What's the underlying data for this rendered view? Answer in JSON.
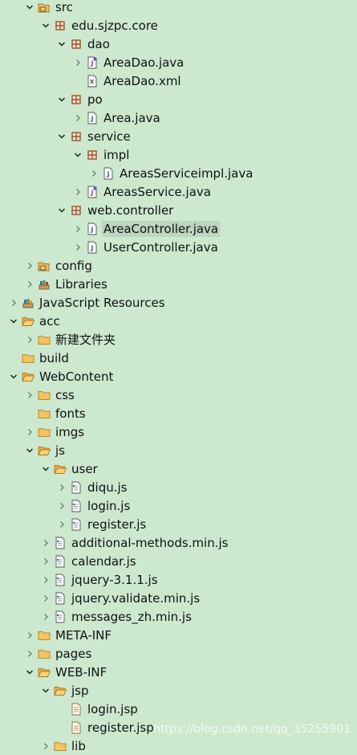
{
  "tree": [
    {
      "label": "src",
      "depth": 2,
      "twisty": "expanded",
      "icon": "source-folder-icon"
    },
    {
      "label": "edu.sjzpc.core",
      "depth": 3,
      "twisty": "expanded",
      "icon": "package-icon"
    },
    {
      "label": "dao",
      "depth": 4,
      "twisty": "expanded",
      "icon": "package-icon"
    },
    {
      "label": "AreaDao.java",
      "depth": 5,
      "twisty": "collapsed",
      "icon": "java-interface-icon"
    },
    {
      "label": "AreaDao.xml",
      "depth": 5,
      "twisty": "none",
      "icon": "xml-file-icon"
    },
    {
      "label": "po",
      "depth": 4,
      "twisty": "expanded",
      "icon": "package-icon"
    },
    {
      "label": "Area.java",
      "depth": 5,
      "twisty": "collapsed",
      "icon": "java-file-icon"
    },
    {
      "label": "service",
      "depth": 4,
      "twisty": "expanded",
      "icon": "package-icon"
    },
    {
      "label": "impl",
      "depth": 5,
      "twisty": "expanded",
      "icon": "package-icon"
    },
    {
      "label": "AreasServiceimpl.java",
      "depth": 6,
      "twisty": "collapsed",
      "icon": "java-file-icon"
    },
    {
      "label": "AreasService.java",
      "depth": 5,
      "twisty": "collapsed",
      "icon": "java-interface-icon"
    },
    {
      "label": "web.controller",
      "depth": 4,
      "twisty": "expanded",
      "icon": "package-icon"
    },
    {
      "label": "AreaController.java",
      "depth": 5,
      "twisty": "collapsed",
      "icon": "java-file-icon",
      "selected": true
    },
    {
      "label": "UserController.java",
      "depth": 5,
      "twisty": "collapsed",
      "icon": "java-file-icon"
    },
    {
      "label": "config",
      "depth": 2,
      "twisty": "collapsed",
      "icon": "source-folder-icon"
    },
    {
      "label": "Libraries",
      "depth": 2,
      "twisty": "collapsed",
      "icon": "libraries-icon"
    },
    {
      "label": "JavaScript Resources",
      "depth": 1,
      "twisty": "collapsed",
      "icon": "js-resources-icon"
    },
    {
      "label": "acc",
      "depth": 1,
      "twisty": "expanded",
      "icon": "folder-open-icon"
    },
    {
      "label": "新建文件夹",
      "depth": 2,
      "twisty": "collapsed",
      "icon": "folder-icon"
    },
    {
      "label": "build",
      "depth": 1,
      "twisty": "none",
      "icon": "folder-icon"
    },
    {
      "label": "WebContent",
      "depth": 1,
      "twisty": "expanded",
      "icon": "folder-open-icon"
    },
    {
      "label": "css",
      "depth": 2,
      "twisty": "collapsed",
      "icon": "folder-icon"
    },
    {
      "label": "fonts",
      "depth": 2,
      "twisty": "none",
      "icon": "folder-icon"
    },
    {
      "label": "imgs",
      "depth": 2,
      "twisty": "collapsed",
      "icon": "folder-icon"
    },
    {
      "label": "js",
      "depth": 2,
      "twisty": "expanded",
      "icon": "folder-open-icon"
    },
    {
      "label": "user",
      "depth": 3,
      "twisty": "expanded",
      "icon": "folder-open-icon"
    },
    {
      "label": "diqu.js",
      "depth": 4,
      "twisty": "collapsed",
      "icon": "js-file-icon"
    },
    {
      "label": "login.js",
      "depth": 4,
      "twisty": "collapsed",
      "icon": "js-file-icon"
    },
    {
      "label": "register.js",
      "depth": 4,
      "twisty": "collapsed",
      "icon": "js-file-icon"
    },
    {
      "label": "additional-methods.min.js",
      "depth": 3,
      "twisty": "collapsed",
      "icon": "js-file-icon"
    },
    {
      "label": "calendar.js",
      "depth": 3,
      "twisty": "collapsed",
      "icon": "js-file-icon"
    },
    {
      "label": "jquery-3.1.1.js",
      "depth": 3,
      "twisty": "collapsed",
      "icon": "js-file-icon"
    },
    {
      "label": "jquery.validate.min.js",
      "depth": 3,
      "twisty": "collapsed",
      "icon": "js-file-icon"
    },
    {
      "label": "messages_zh.min.js",
      "depth": 3,
      "twisty": "collapsed",
      "icon": "js-file-icon"
    },
    {
      "label": "META-INF",
      "depth": 2,
      "twisty": "collapsed",
      "icon": "folder-icon"
    },
    {
      "label": "pages",
      "depth": 2,
      "twisty": "collapsed",
      "icon": "folder-icon"
    },
    {
      "label": "WEB-INF",
      "depth": 2,
      "twisty": "expanded",
      "icon": "folder-open-icon"
    },
    {
      "label": "jsp",
      "depth": 3,
      "twisty": "expanded",
      "icon": "folder-open-icon"
    },
    {
      "label": "login.jsp",
      "depth": 4,
      "twisty": "none",
      "icon": "jsp-file-icon"
    },
    {
      "label": "register.jsp",
      "depth": 4,
      "twisty": "none",
      "icon": "jsp-file-icon"
    },
    {
      "label": "lib",
      "depth": 3,
      "twisty": "collapsed",
      "icon": "folder-icon"
    }
  ],
  "watermark": "https://blog.csdn.net/qq_35255901",
  "colors": {
    "background": "#cce8cf",
    "selection": "#bcd6c0",
    "folder": "#e8a33c",
    "package": "#a0522d",
    "java": "#2a5ca8"
  }
}
